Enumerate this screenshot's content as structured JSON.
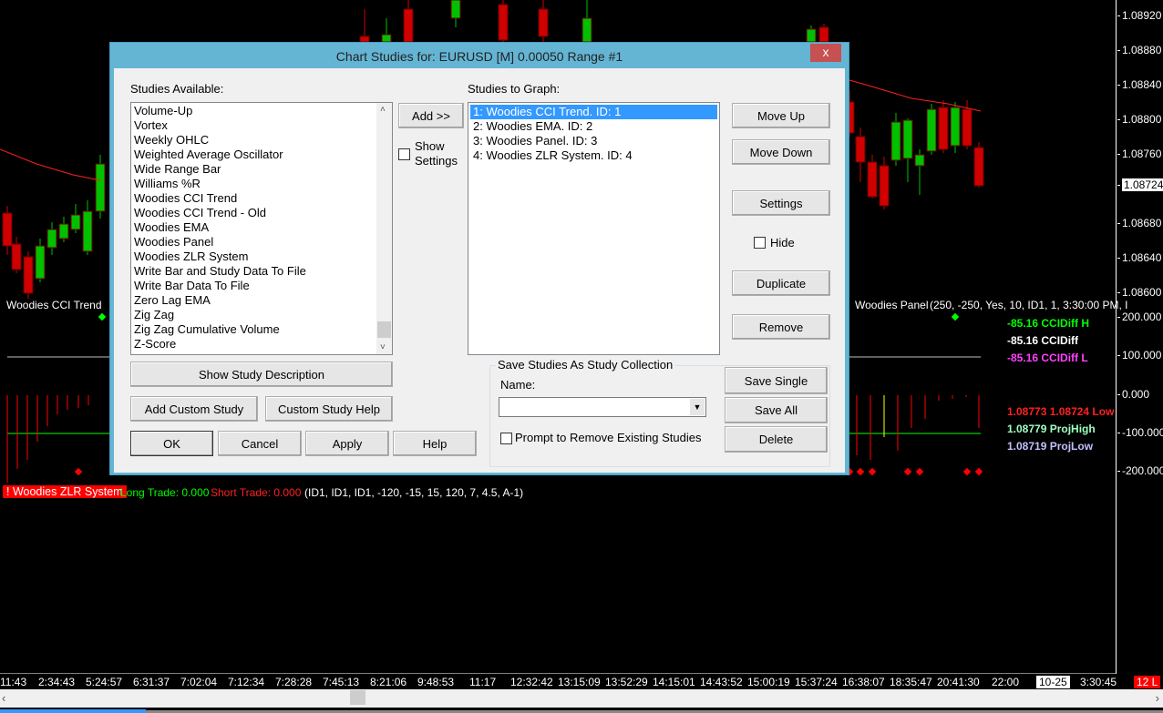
{
  "chart": {
    "price_labels": [
      "1.08920",
      "1.08880",
      "1.08840",
      "1.08800",
      "1.08760",
      "1.08680",
      "1.08640",
      "1.08600"
    ],
    "current_price": "1.08724",
    "cci_labels": [
      "200.000",
      "100.000",
      "0.000",
      "-100.000",
      "-200.000"
    ],
    "time_labels": [
      "11:43",
      "2:34:43",
      "5:24:57",
      "6:31:37",
      "7:02:04",
      "7:12:34",
      "7:28:28",
      "7:45:13",
      "8:21:06",
      "9:48:53",
      "11:17",
      "12:32:42",
      "13:15:09",
      "13:52:29",
      "14:15:01",
      "14:43:52",
      "15:00:19",
      "15:37:24",
      "16:38:07",
      "18:35:47",
      "20:41:30",
      "22:00"
    ],
    "date_marker": "10-25",
    "last_time": "3:30:45",
    "status_badge": "12 L",
    "cci_trend_label": "Woodies CCI Trend",
    "panel_label": "Woodies Panel",
    "panel_params": "(250, -250, Yes, 10, ID1, 1, 3:30:00 PM, I",
    "cci_diff_h": "-85.16 CCIDiff H",
    "cci_diff": "-85.16 CCIDiff",
    "cci_diff_l": "-85.16 CCIDiff L",
    "high_low": "1.08773 1.08724 Low",
    "proj_high": "1.08779 ProjHigh",
    "proj_low": "1.08719 ProjLow",
    "zlr_label": "! Woodies ZLR System",
    "long_trade": "Long Trade: 0.000",
    "short_trade": "Short Trade: 0.000",
    "zlr_params": "(ID1, ID1, ID1, -120, -15, 15, 120, 7, 4.5, A-1)",
    "colors": {
      "up": "#00c000",
      "down": "#d00000",
      "cci_h": "#00ff00",
      "cci_l": "#ff40ff",
      "proj_high": "#a0ffc0",
      "proj_low": "#c0c0ff"
    }
  },
  "dialog": {
    "title": "Chart Studies for: EURUSD [M]  0.00050 Range  #1",
    "close": "x",
    "studies_available_label": "Studies Available:",
    "studies_available": [
      "Volume-Up",
      "Vortex",
      "Weekly OHLC",
      "Weighted Average Oscillator",
      "Wide Range Bar",
      "Williams %R",
      "Woodies CCI Trend",
      "Woodies CCI Trend - Old",
      "Woodies EMA",
      "Woodies Panel",
      "Woodies ZLR System",
      "Write Bar and Study Data To File",
      "Write Bar Data To File",
      "Zero Lag EMA",
      "Zig Zag",
      "Zig Zag Cumulative Volume",
      "Z-Score"
    ],
    "add_button": "Add >>",
    "show_settings": "Show Settings",
    "studies_to_graph_label": "Studies to Graph:",
    "studies_to_graph": [
      "1: Woodies CCI Trend. ID: 1",
      "2: Woodies EMA. ID: 2",
      "3: Woodies Panel. ID: 3",
      "4: Woodies ZLR System. ID: 4"
    ],
    "move_up": "Move Up",
    "move_down": "Move Down",
    "settings": "Settings",
    "hide": "Hide",
    "duplicate": "Duplicate",
    "remove": "Remove",
    "show_study_description": "Show Study Description",
    "add_custom_study": "Add Custom Study",
    "custom_study_help": "Custom Study Help",
    "ok": "OK",
    "cancel": "Cancel",
    "apply": "Apply",
    "help": "Help",
    "collection_group": "Save Studies As Study Collection",
    "name_label": "Name:",
    "name_value": "",
    "prompt_remove": "Prompt to Remove Existing Studies",
    "save_single": "Save Single",
    "save_all": "Save All",
    "delete": "Delete"
  }
}
